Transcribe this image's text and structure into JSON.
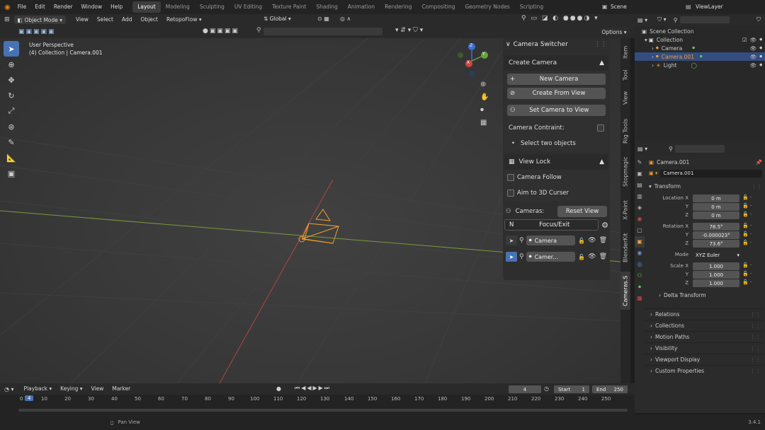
{
  "topbar": {
    "menus": [
      "File",
      "Edit",
      "Render",
      "Window",
      "Help"
    ],
    "workspaces": [
      "Layout",
      "Modeling",
      "Sculpting",
      "UV Editing",
      "Texture Paint",
      "Shading",
      "Animation",
      "Rendering",
      "Compositing",
      "Geometry Nodes",
      "Scripting"
    ],
    "scene": "Scene",
    "view_layer": "ViewLayer"
  },
  "viewport_header": {
    "mode": "Object Mode",
    "menus": [
      "View",
      "Select",
      "Add",
      "Object"
    ],
    "addon_menu": "RetopoFlow",
    "orientation": "Global",
    "options": "Options"
  },
  "viewport": {
    "perspective": "User Perspective",
    "collection_info": "(4) Collection | Camera.001",
    "gizmo": {
      "z": "Z",
      "y": "Y",
      "x": "X"
    }
  },
  "camera_panel": {
    "title": "Camera Switcher",
    "create_title": "Create Camera",
    "new_camera": "New Camera",
    "create_from_view": "Create From View",
    "set_camera_to_view": "Set Camera to View",
    "constraint_label": "Camera Contraint:",
    "select_two": "Select two objects",
    "view_lock": "View Lock",
    "camera_follow": "Camera Follow",
    "aim_cursor": "Aim to 3D Curser",
    "cameras_label": "Cameras:",
    "reset_view": "Reset View",
    "focus_key": "N",
    "focus_exit": "Focus/Exit",
    "camera_list": [
      {
        "name": "Camera"
      },
      {
        "name": "Camer..."
      }
    ]
  },
  "side_tabs": [
    "Item",
    "Tool",
    "View",
    "Rig Tools",
    "Stopmagic",
    "X-Paint",
    "BlenderKit",
    "Cameras.S"
  ],
  "outliner": {
    "scene_collection": "Scene Collection",
    "collection": "Collection",
    "items": [
      {
        "name": "Camera",
        "selected": false
      },
      {
        "name": "Camera.001",
        "selected": true
      },
      {
        "name": "Light",
        "selected": false
      }
    ]
  },
  "properties": {
    "object_name": "Camera.001",
    "data_name": "Camera.001",
    "transform_title": "Transform",
    "location_label": "Location X",
    "location": [
      "0 m",
      "0 m",
      "0 m"
    ],
    "rotation_label": "Rotation X",
    "rotation": [
      "78.5°",
      "-0.000023°",
      "73.6°"
    ],
    "mode_label": "Mode",
    "mode": "XYZ Euler",
    "scale_label": "Scale X",
    "scale": [
      "1.000",
      "1.000",
      "1.000"
    ],
    "axes": [
      "Y",
      "Z"
    ],
    "delta": "Delta Transform",
    "sections": [
      "Relations",
      "Collections",
      "Motion Paths",
      "Visibility",
      "Viewport Display",
      "Custom Properties"
    ]
  },
  "timeline": {
    "menus": [
      "Playback",
      "Keying",
      "View",
      "Marker"
    ],
    "current_frame": "4",
    "start_label": "Start",
    "start": "1",
    "end_label": "End",
    "end": "250",
    "ticks": [
      "0",
      "4",
      "10",
      "20",
      "30",
      "40",
      "50",
      "60",
      "70",
      "80",
      "90",
      "100",
      "110",
      "120",
      "130",
      "140",
      "150",
      "160",
      "170",
      "180",
      "190",
      "200",
      "210",
      "220",
      "230",
      "240",
      "250"
    ]
  },
  "status": {
    "hint": "Pan View",
    "version": "3.4.1"
  },
  "colors": {
    "accent": "#4772b3",
    "selected_row": "#334d80",
    "camera_orange": "#f0a030"
  }
}
